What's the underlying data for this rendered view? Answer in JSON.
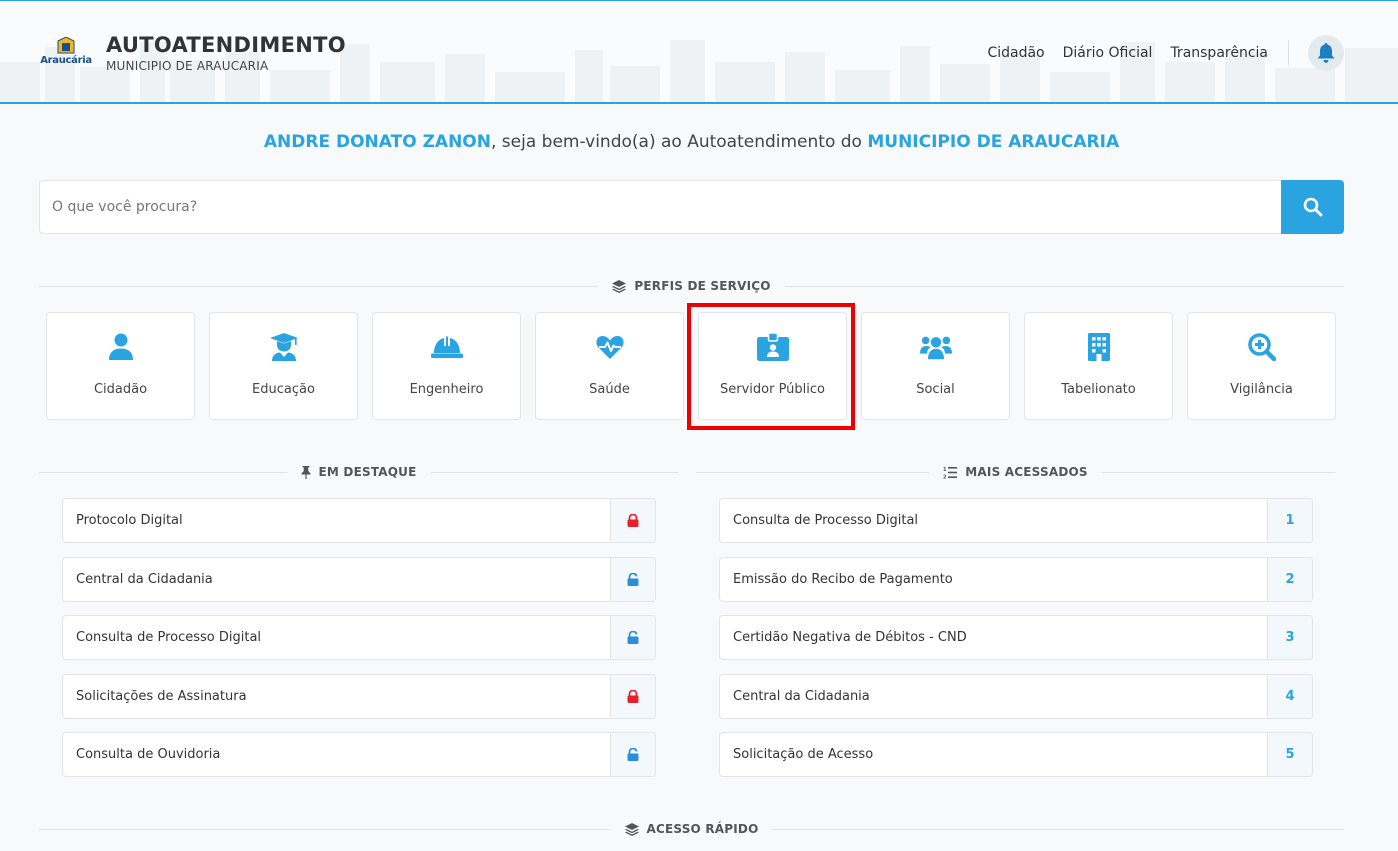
{
  "header": {
    "logo_text": "Araucária",
    "title": "AUTOATENDIMENTO",
    "subtitle": "MUNICIPIO DE ARAUCARIA",
    "nav": [
      "Cidadão",
      "Diário Oficial",
      "Transparência"
    ]
  },
  "welcome": {
    "user": "ANDRE DONATO ZANON",
    "middle": ", seja bem-vindo(a) ao Autoatendimento do ",
    "org": "MUNICIPIO DE ARAUCARIA"
  },
  "search": {
    "placeholder": "O que você procura?"
  },
  "profiles": {
    "title": "PERFIS DE SERVIÇO",
    "items": [
      {
        "label": "Cidadão",
        "icon": "user-icon"
      },
      {
        "label": "Educação",
        "icon": "graduate-icon"
      },
      {
        "label": "Engenheiro",
        "icon": "hard-hat-icon"
      },
      {
        "label": "Saúde",
        "icon": "heartbeat-icon"
      },
      {
        "label": "Servidor Público",
        "icon": "id-badge-icon"
      },
      {
        "label": "Social",
        "icon": "users-icon"
      },
      {
        "label": "Tabelionato",
        "icon": "building-icon"
      },
      {
        "label": "Vigilância",
        "icon": "search-plus-icon"
      }
    ]
  },
  "featured": {
    "title": "EM DESTAQUE",
    "items": [
      {
        "label": "Protocolo Digital",
        "lock": "locked"
      },
      {
        "label": "Central da Cidadania",
        "lock": "unlocked"
      },
      {
        "label": "Consulta de Processo Digital",
        "lock": "unlocked"
      },
      {
        "label": "Solicitações de Assinatura",
        "lock": "locked"
      },
      {
        "label": "Consulta de Ouvidoria",
        "lock": "unlocked"
      }
    ]
  },
  "most_accessed": {
    "title": "MAIS ACESSADOS",
    "items": [
      {
        "label": "Consulta de Processo Digital",
        "rank": "1"
      },
      {
        "label": "Emissão do Recibo de Pagamento",
        "rank": "2"
      },
      {
        "label": "Certidão Negativa de Débitos - CND",
        "rank": "3"
      },
      {
        "label": "Central da Cidadania",
        "rank": "4"
      },
      {
        "label": "Solicitação de Acesso",
        "rank": "5"
      }
    ]
  },
  "quick_access": {
    "title": "ACESSO RÁPIDO"
  },
  "colors": {
    "accent": "#2aa4e0",
    "locked": "#e8202a",
    "unlocked": "#2a8fd6",
    "highlight": "#e00000"
  }
}
